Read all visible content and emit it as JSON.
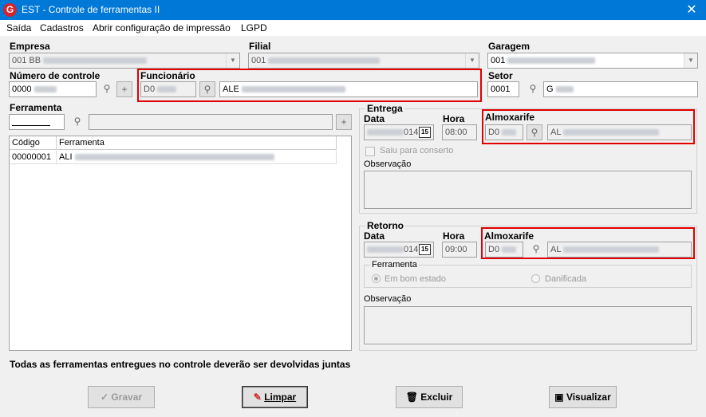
{
  "window": {
    "title": "EST - Controle de ferramentas II",
    "app_icon": "G",
    "close": "✕"
  },
  "menu": [
    "Saída",
    "Cadastros",
    "Abrir configuração de impressão",
    "LGPD"
  ],
  "empresa": {
    "label": "Empresa",
    "value": "001 BB"
  },
  "filial": {
    "label": "Filial",
    "value": "001"
  },
  "garagem": {
    "label": "Garagem",
    "value": "001"
  },
  "numero_controle": {
    "label": "Número de controle",
    "value": "0000"
  },
  "funcionario": {
    "label": "Funcionário",
    "code": "D0",
    "name": "ALE"
  },
  "setor": {
    "label": "Setor",
    "code": "0001",
    "name": "G"
  },
  "ferramenta": {
    "label": "Ferramenta",
    "columns": [
      "Código",
      "Ferramenta"
    ],
    "rows": [
      {
        "codigo": "00000001",
        "ferramenta": "ALI"
      }
    ]
  },
  "entrega": {
    "title": "Entrega",
    "data_label": "Data",
    "data_value": "014",
    "hora_label": "Hora",
    "hora_value": "08:00",
    "almox_label": "Almoxarife",
    "almox_code": "D0",
    "almox_name": "AL",
    "conserto_label": "Saiu para conserto",
    "obs_label": "Observação"
  },
  "retorno": {
    "title": "Retorno",
    "data_label": "Data",
    "data_value": "014",
    "hora_label": "Hora",
    "hora_value": "09:00",
    "almox_label": "Almoxarife",
    "almox_code": "D0",
    "almox_name": "AL",
    "ferramenta_group": "Ferramenta",
    "bom_estado": "Em bom estado",
    "danificada": "Danificada",
    "obs_label": "Observação"
  },
  "notice": "Todas as ferramentas entregues  no controle deverão ser devolvidas juntas",
  "buttons": {
    "gravar": "Gravar",
    "limpar": "Limpar",
    "excluir": "Excluir",
    "visualizar": "Visualizar"
  },
  "icons": {
    "search": "binoculars-icon",
    "add": "plus-icon",
    "calendar": "calendar-icon"
  },
  "calendar_text": "15",
  "colors": {
    "titlebar": "#0078d7",
    "highlight": "#e00000"
  }
}
